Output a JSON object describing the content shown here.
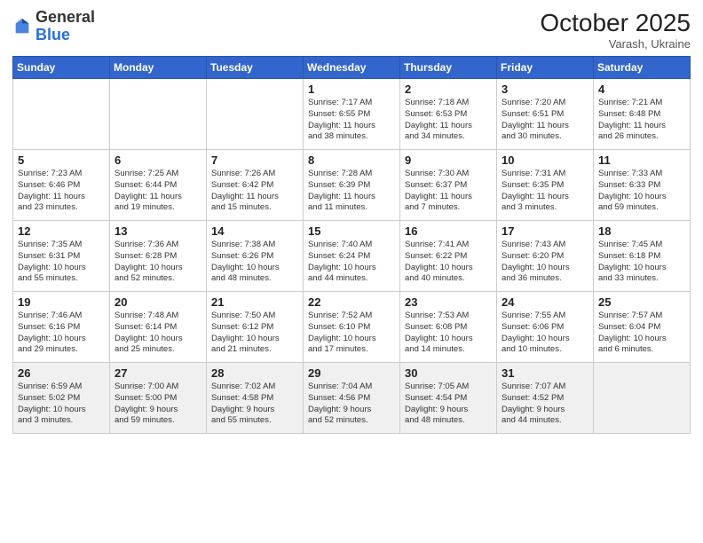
{
  "header": {
    "logo_general": "General",
    "logo_blue": "Blue",
    "month": "October 2025",
    "location": "Varash, Ukraine"
  },
  "weekdays": [
    "Sunday",
    "Monday",
    "Tuesday",
    "Wednesday",
    "Thursday",
    "Friday",
    "Saturday"
  ],
  "weeks": [
    [
      {
        "day": "",
        "info": ""
      },
      {
        "day": "",
        "info": ""
      },
      {
        "day": "",
        "info": ""
      },
      {
        "day": "1",
        "info": "Sunrise: 7:17 AM\nSunset: 6:55 PM\nDaylight: 11 hours\nand 38 minutes."
      },
      {
        "day": "2",
        "info": "Sunrise: 7:18 AM\nSunset: 6:53 PM\nDaylight: 11 hours\nand 34 minutes."
      },
      {
        "day": "3",
        "info": "Sunrise: 7:20 AM\nSunset: 6:51 PM\nDaylight: 11 hours\nand 30 minutes."
      },
      {
        "day": "4",
        "info": "Sunrise: 7:21 AM\nSunset: 6:48 PM\nDaylight: 11 hours\nand 26 minutes."
      }
    ],
    [
      {
        "day": "5",
        "info": "Sunrise: 7:23 AM\nSunset: 6:46 PM\nDaylight: 11 hours\nand 23 minutes."
      },
      {
        "day": "6",
        "info": "Sunrise: 7:25 AM\nSunset: 6:44 PM\nDaylight: 11 hours\nand 19 minutes."
      },
      {
        "day": "7",
        "info": "Sunrise: 7:26 AM\nSunset: 6:42 PM\nDaylight: 11 hours\nand 15 minutes."
      },
      {
        "day": "8",
        "info": "Sunrise: 7:28 AM\nSunset: 6:39 PM\nDaylight: 11 hours\nand 11 minutes."
      },
      {
        "day": "9",
        "info": "Sunrise: 7:30 AM\nSunset: 6:37 PM\nDaylight: 11 hours\nand 7 minutes."
      },
      {
        "day": "10",
        "info": "Sunrise: 7:31 AM\nSunset: 6:35 PM\nDaylight: 11 hours\nand 3 minutes."
      },
      {
        "day": "11",
        "info": "Sunrise: 7:33 AM\nSunset: 6:33 PM\nDaylight: 10 hours\nand 59 minutes."
      }
    ],
    [
      {
        "day": "12",
        "info": "Sunrise: 7:35 AM\nSunset: 6:31 PM\nDaylight: 10 hours\nand 55 minutes."
      },
      {
        "day": "13",
        "info": "Sunrise: 7:36 AM\nSunset: 6:28 PM\nDaylight: 10 hours\nand 52 minutes."
      },
      {
        "day": "14",
        "info": "Sunrise: 7:38 AM\nSunset: 6:26 PM\nDaylight: 10 hours\nand 48 minutes."
      },
      {
        "day": "15",
        "info": "Sunrise: 7:40 AM\nSunset: 6:24 PM\nDaylight: 10 hours\nand 44 minutes."
      },
      {
        "day": "16",
        "info": "Sunrise: 7:41 AM\nSunset: 6:22 PM\nDaylight: 10 hours\nand 40 minutes."
      },
      {
        "day": "17",
        "info": "Sunrise: 7:43 AM\nSunset: 6:20 PM\nDaylight: 10 hours\nand 36 minutes."
      },
      {
        "day": "18",
        "info": "Sunrise: 7:45 AM\nSunset: 6:18 PM\nDaylight: 10 hours\nand 33 minutes."
      }
    ],
    [
      {
        "day": "19",
        "info": "Sunrise: 7:46 AM\nSunset: 6:16 PM\nDaylight: 10 hours\nand 29 minutes."
      },
      {
        "day": "20",
        "info": "Sunrise: 7:48 AM\nSunset: 6:14 PM\nDaylight: 10 hours\nand 25 minutes."
      },
      {
        "day": "21",
        "info": "Sunrise: 7:50 AM\nSunset: 6:12 PM\nDaylight: 10 hours\nand 21 minutes."
      },
      {
        "day": "22",
        "info": "Sunrise: 7:52 AM\nSunset: 6:10 PM\nDaylight: 10 hours\nand 17 minutes."
      },
      {
        "day": "23",
        "info": "Sunrise: 7:53 AM\nSunset: 6:08 PM\nDaylight: 10 hours\nand 14 minutes."
      },
      {
        "day": "24",
        "info": "Sunrise: 7:55 AM\nSunset: 6:06 PM\nDaylight: 10 hours\nand 10 minutes."
      },
      {
        "day": "25",
        "info": "Sunrise: 7:57 AM\nSunset: 6:04 PM\nDaylight: 10 hours\nand 6 minutes."
      }
    ],
    [
      {
        "day": "26",
        "info": "Sunrise: 6:59 AM\nSunset: 5:02 PM\nDaylight: 10 hours\nand 3 minutes."
      },
      {
        "day": "27",
        "info": "Sunrise: 7:00 AM\nSunset: 5:00 PM\nDaylight: 9 hours\nand 59 minutes."
      },
      {
        "day": "28",
        "info": "Sunrise: 7:02 AM\nSunset: 4:58 PM\nDaylight: 9 hours\nand 55 minutes."
      },
      {
        "day": "29",
        "info": "Sunrise: 7:04 AM\nSunset: 4:56 PM\nDaylight: 9 hours\nand 52 minutes."
      },
      {
        "day": "30",
        "info": "Sunrise: 7:05 AM\nSunset: 4:54 PM\nDaylight: 9 hours\nand 48 minutes."
      },
      {
        "day": "31",
        "info": "Sunrise: 7:07 AM\nSunset: 4:52 PM\nDaylight: 9 hours\nand 44 minutes."
      },
      {
        "day": "",
        "info": ""
      }
    ]
  ]
}
